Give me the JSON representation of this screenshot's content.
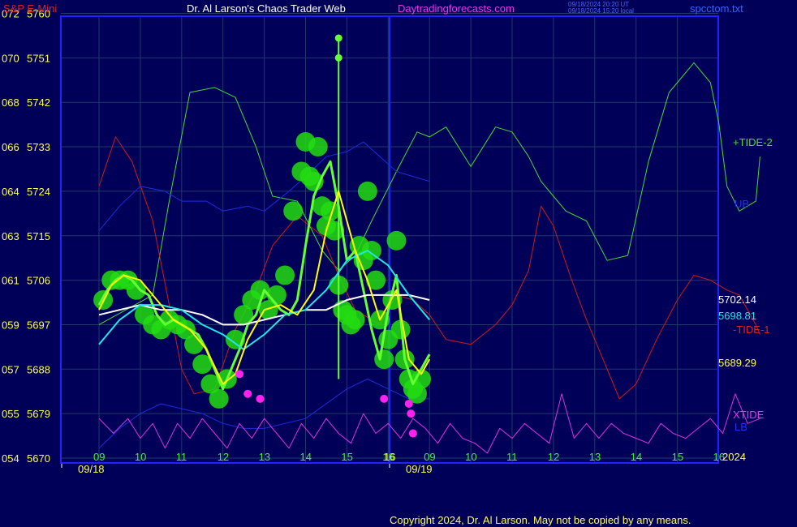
{
  "header": {
    "instrument": "S&P E-Mini",
    "title": "Dr. Al Larson's Chaos Trader Web",
    "site": "Daytradingforecasts.com",
    "timestamp_ut": "09/18/2024 20:20 UT",
    "timestamp_local": "09/18/2024 15:20 local",
    "file": "spcctom.txt"
  },
  "footer": {
    "copyright": "Copyright 2024, Dr. Al Larson. May not be copied by any means."
  },
  "colors": {
    "background": "#000058",
    "frame": "#2222ff",
    "grid": "#1e3a6a",
    "tide2": "#44dd33",
    "tide1": "#d01818",
    "ub": "#1e2ce0",
    "lb": "#1e2ce0",
    "xtide": "#e030e0",
    "price": "#66ff33",
    "bubble": "#22dd11",
    "yellow": "#ffff00",
    "cyan": "#22e6e6",
    "white": "#ffffff",
    "magenta": "#ff22ee"
  },
  "chart_data": {
    "type": "line",
    "y_labels": [
      {
        "code": "072",
        "price": "5760"
      },
      {
        "code": "070",
        "price": "5751"
      },
      {
        "code": "068",
        "price": "5742"
      },
      {
        "code": "066",
        "price": "5733"
      },
      {
        "code": "064",
        "price": "5724"
      },
      {
        "code": "063",
        "price": "5715"
      },
      {
        "code": "061",
        "price": "5706"
      },
      {
        "code": "059",
        "price": "5697"
      },
      {
        "code": "057",
        "price": "5688"
      },
      {
        "code": "055",
        "price": "5679"
      },
      {
        "code": "054",
        "price": "5670"
      }
    ],
    "ylim": [
      5670,
      5760
    ],
    "x_hour_ticks": [
      "09",
      "10",
      "11",
      "12",
      "13",
      "14",
      "15",
      "16",
      "09",
      "10",
      "11",
      "12",
      "13",
      "14",
      "15",
      "16"
    ],
    "date_labels": [
      "09/18",
      "09/19"
    ],
    "year_label": "2024",
    "now_value": "16",
    "right_labels": {
      "tide2": "+TIDE-2",
      "ub": "UB",
      "last_white": "5702.14",
      "last_cyan": "5698.81",
      "tide1": "-TIDE-1",
      "last_yellow": "5689.29",
      "xtide": "XTIDE",
      "lb": "LB"
    },
    "series": [
      {
        "name": "+TIDE-2",
        "key": "tide2",
        "x": [
          0,
          1.3,
          1.7,
          2.2,
          2.8,
          3.3,
          3.8,
          4.2,
          4.8,
          5.4,
          5.8,
          6.2,
          6.6,
          7.2,
          7.7,
          8,
          8.4,
          9,
          9.6,
          10,
          10.4,
          10.7,
          11,
          11.3,
          11.8,
          12.3,
          12.8,
          13.3,
          13.8,
          14.4,
          14.8,
          15,
          15.2,
          15.5,
          15.9,
          16
        ],
        "y": [
          5697,
          5703,
          5722,
          5744,
          5745,
          5743,
          5733,
          5723,
          5722,
          5712,
          5708,
          5711,
          5718,
          5728,
          5736,
          5735,
          5737,
          5729,
          5737,
          5736,
          5731,
          5726,
          5723,
          5720,
          5718,
          5710,
          5711,
          5730,
          5744,
          5750,
          5746,
          5738,
          5725,
          5720,
          5722,
          5731
        ]
      },
      {
        "name": "-TIDE-1",
        "key": "tide1",
        "x": [
          0,
          0.4,
          0.8,
          1.3,
          1.7,
          2,
          2.3,
          2.8,
          3.3,
          3.8,
          4.2,
          4.8,
          5.4,
          5.8,
          6.2,
          6.8,
          7.2,
          7.6,
          8,
          8.4,
          9,
          9.6,
          10,
          10.4,
          10.7,
          11,
          11.4,
          11.8,
          12.2,
          12.6,
          13,
          13.5,
          14,
          14.4,
          14.8,
          15.2,
          15.5,
          15.9,
          16
        ],
        "y": [
          5725,
          5735,
          5730,
          5718,
          5701,
          5688,
          5683,
          5684,
          5696,
          5704,
          5713,
          5719,
          5715,
          5707,
          5700,
          5697,
          5703,
          5702,
          5699,
          5694,
          5693,
          5697,
          5701,
          5708,
          5721,
          5717,
          5707,
          5698,
          5690,
          5682,
          5685,
          5694,
          5702,
          5707,
          5706,
          5704,
          5703,
          5697,
          5695
        ]
      },
      {
        "name": "UB",
        "key": "ub",
        "x": [
          0,
          0.5,
          1,
          1.6,
          2,
          2.6,
          3,
          3.6,
          4,
          4.6,
          5,
          5.5,
          6,
          6.4,
          6.8,
          7.2,
          7.6,
          8
        ],
        "y": [
          5716,
          5721,
          5725,
          5724,
          5722,
          5722,
          5720,
          5721,
          5720,
          5724,
          5727,
          5731,
          5732,
          5734,
          5731,
          5728,
          5727,
          5726
        ]
      },
      {
        "name": "LB",
        "key": "lb",
        "x": [
          0,
          0.5,
          1,
          1.5,
          2,
          2.5,
          3,
          3.5,
          4,
          4.5,
          5,
          5.5,
          6,
          6.5,
          7,
          7.5,
          8
        ],
        "y": [
          5672,
          5676,
          5679,
          5681,
          5680,
          5679,
          5677,
          5676,
          5676,
          5677,
          5678,
          5681,
          5684,
          5686,
          5684,
          5682,
          5682
        ]
      },
      {
        "name": "XTIDE",
        "key": "xtide",
        "x": [
          0,
          0.35,
          0.7,
          1,
          1.3,
          1.6,
          1.9,
          2.2,
          2.5,
          2.8,
          3.1,
          3.4,
          3.7,
          4,
          4.3,
          4.6,
          4.9,
          5.2,
          5.5,
          5.8,
          6.1,
          6.4,
          6.7,
          7,
          7.3,
          7.6,
          7.9,
          8.2,
          8.5,
          8.8,
          9.1,
          9.4,
          9.7,
          10,
          10.3,
          10.6,
          10.9,
          11.2,
          11.5,
          11.8,
          12.1,
          12.4,
          12.7,
          13,
          13.3,
          13.6,
          13.9,
          14.2,
          14.5,
          14.8,
          15.1,
          15.4,
          15.7,
          16
        ],
        "y": [
          5678,
          5675,
          5678,
          5674,
          5677,
          5672,
          5677,
          5674,
          5678,
          5675,
          5672,
          5677,
          5674,
          5678,
          5675,
          5672,
          5677,
          5674,
          5678,
          5675,
          5673,
          5679,
          5675,
          5677,
          5674,
          5678,
          5676,
          5673,
          5677,
          5674,
          5673,
          5671,
          5676,
          5674,
          5677,
          5675,
          5673,
          5683,
          5674,
          5677,
          5674,
          5677,
          5675,
          5674,
          5673,
          5677,
          5675,
          5674,
          5676,
          5678,
          5675,
          5683,
          5677,
          5678
        ]
      },
      {
        "name": "Price",
        "key": "price",
        "x": [
          0,
          0.2,
          0.4,
          0.6,
          0.8,
          1,
          1.2,
          1.4,
          1.6,
          1.8,
          2,
          2.2,
          2.4,
          2.6,
          2.8,
          3,
          3.2,
          3.4,
          3.6,
          3.8,
          4,
          4.2,
          4.4,
          4.6,
          4.8,
          5,
          5.2,
          5.4,
          5.6,
          5.8,
          6,
          6.2,
          6.4,
          6.6,
          6.8,
          7,
          7.2,
          7.4,
          7.6,
          7.8,
          8
        ],
        "y": [
          5701,
          5704,
          5706,
          5707,
          5706,
          5704,
          5703,
          5699,
          5697,
          5698,
          5697,
          5696,
          5695,
          5692,
          5688,
          5684,
          5688,
          5692,
          5697,
          5699,
          5704,
          5702,
          5700,
          5699,
          5702,
          5713,
          5723,
          5727,
          5730,
          5721,
          5710,
          5712,
          5704,
          5696,
          5690,
          5700,
          5707,
          5690,
          5685,
          5688,
          5691
        ]
      },
      {
        "name": "Yellow",
        "key": "yellow",
        "x": [
          0,
          0.3,
          0.6,
          1,
          1.4,
          1.8,
          2.2,
          2.6,
          3,
          3.3,
          3.6,
          4,
          4.4,
          4.8,
          5.2,
          5.5,
          5.8,
          6.2,
          6.5,
          6.8,
          7.2,
          7.5,
          7.8,
          8
        ],
        "y": [
          5700,
          5705,
          5707,
          5706,
          5702,
          5698,
          5696,
          5692,
          5685,
          5687,
          5694,
          5700,
          5701,
          5699,
          5704,
          5716,
          5724,
          5712,
          5706,
          5698,
          5704,
          5690,
          5687,
          5690
        ]
      },
      {
        "name": "Cyan",
        "key": "cyan",
        "x": [
          0,
          0.5,
          1,
          1.5,
          2,
          2.5,
          3,
          3.5,
          4,
          4.5,
          5,
          5.5,
          6,
          6.5,
          7,
          7.5,
          8
        ],
        "y": [
          5693,
          5698,
          5701,
          5701,
          5700,
          5697,
          5695,
          5692,
          5695,
          5699,
          5700,
          5704,
          5710,
          5712,
          5709,
          5703,
          5698
        ]
      },
      {
        "name": "White",
        "key": "white",
        "x": [
          0,
          0.5,
          1,
          1.5,
          2,
          2.5,
          3,
          3.5,
          4,
          4.5,
          5,
          5.5,
          6,
          6.5,
          7,
          7.5,
          8
        ],
        "y": [
          5699,
          5700,
          5701,
          5700,
          5700,
          5699,
          5697,
          5697,
          5698,
          5699,
          5700,
          5700,
          5702,
          5703,
          5703,
          5703,
          5702
        ]
      }
    ],
    "bubbles_x": [
      0.1,
      0.3,
      0.5,
      0.7,
      0.9,
      1.1,
      1.3,
      1.5,
      1.7,
      1.9,
      2.1,
      2.3,
      2.5,
      2.7,
      2.9,
      3.1,
      3.3,
      3.5,
      3.7,
      3.9,
      4.1,
      4.3,
      4.5,
      4.7,
      4.9,
      5,
      5.1,
      5.2,
      5.3,
      5.4,
      5.5,
      5.6,
      5.7,
      5.8,
      5.9,
      6,
      6.1,
      6.2,
      6.3,
      6.4,
      6.5,
      6.6,
      6.7,
      6.8,
      6.9,
      7,
      7.1,
      7.2,
      7.3,
      7.4,
      7.5,
      7.6,
      7.7,
      7.8
    ],
    "bubbles_y": [
      5702,
      5706,
      5706,
      5706,
      5704,
      5699,
      5697,
      5696,
      5698,
      5697,
      5696,
      5693,
      5689,
      5685,
      5682,
      5686,
      5694,
      5699,
      5702,
      5704,
      5700,
      5703,
      5707,
      5720,
      5728,
      5734,
      5727,
      5726,
      5733,
      5721,
      5717,
      5720,
      5716,
      5705,
      5700,
      5699,
      5697,
      5698,
      5713,
      5710,
      5724,
      5712,
      5706,
      5698,
      5690,
      5694,
      5702,
      5714,
      5696,
      5690,
      5686,
      5684,
      5683,
      5686
    ],
    "wick": {
      "x": 5.8,
      "y_low": 5686,
      "y_high": 5755
    },
    "green_dots": [
      {
        "x": 5.8,
        "y": 5755
      },
      {
        "x": 5.8,
        "y": 5751
      }
    ],
    "magenta_dots": [
      {
        "x": 3.4,
        "y": 5687
      },
      {
        "x": 3.6,
        "y": 5683
      },
      {
        "x": 3.9,
        "y": 5682
      },
      {
        "x": 6.9,
        "y": 5682
      },
      {
        "x": 7.5,
        "y": 5681
      },
      {
        "x": 7.55,
        "y": 5679
      },
      {
        "x": 7.6,
        "y": 5675
      }
    ]
  }
}
